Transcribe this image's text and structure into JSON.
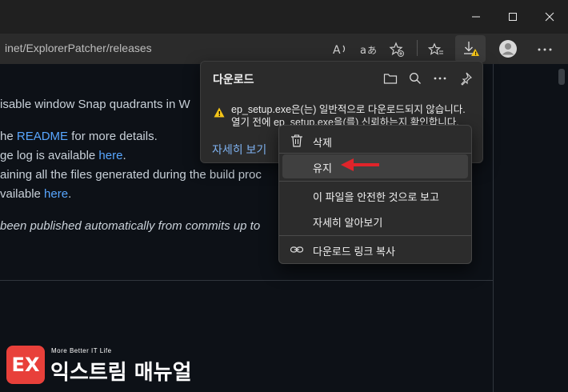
{
  "window": {
    "minimize_icon": "minimize-icon",
    "maximize_icon": "maximize-icon",
    "close_icon": "close-icon"
  },
  "addressbar": {
    "url": "inet/ExplorerPatcher/releases"
  },
  "page": {
    "line1": "isable window Snap quadrants in W",
    "line2_pre": "he ",
    "line2_link": "README",
    "line2_post": " for more details.",
    "line3_pre": "ge log is available ",
    "line3_link": "here",
    "line3_post": ".",
    "line4": "aining all the files generated during the build proc",
    "line5_pre": "vailable ",
    "line5_link": "here",
    "line5_post": ".",
    "line6": "been published automatically from commits up to"
  },
  "download_panel": {
    "title": "다운로드",
    "warning_line1": "ep_setup.exe은(는) 일반적으로 다운로드되지 않습니다.",
    "warning_line2": "열기 전에 ep_setup.exe을(를) 신뢰하는지 확인합니다.",
    "detail_button": "자세히 보기"
  },
  "context_menu": {
    "delete": "삭제",
    "keep": "유지",
    "report_safe": "이 파일을 안전한 것으로 보고",
    "learn_more": "자세히 알아보기",
    "copy_link": "다운로드 링크 복사"
  },
  "logo": {
    "tagline": "More Better IT Life",
    "name": "익스트림 매뉴얼",
    "mark": "EX"
  },
  "colors": {
    "accent_link": "#58a6ff",
    "warning": "#f5c518",
    "arrow": "#e0242a",
    "logo_red": "#e8403a"
  }
}
